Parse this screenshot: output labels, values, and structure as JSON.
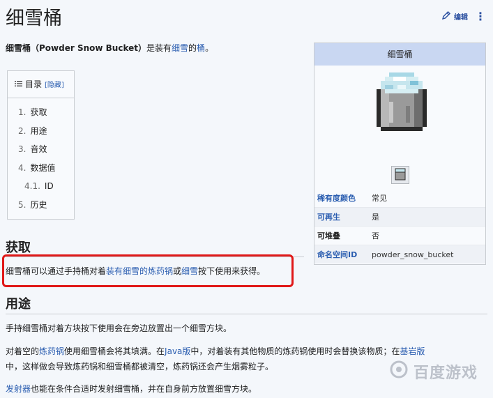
{
  "page": {
    "title": "细雪桶",
    "edit_label": "编辑",
    "more_label": "⋮"
  },
  "intro": {
    "bold_term": "细雪桶",
    "bold_english": "（Powder Snow Bucket）",
    "text_1": "是装有",
    "link_1": "细雪",
    "text_2": "的",
    "link_2": "桶",
    "text_3": "。"
  },
  "toc": {
    "heading": "目录",
    "toggle": "[隐藏]",
    "items": [
      {
        "num": "1.",
        "label": "获取"
      },
      {
        "num": "2.",
        "label": "用途"
      },
      {
        "num": "3.",
        "label": "音效"
      },
      {
        "num": "4.",
        "label": "数据值"
      },
      {
        "num": "4.1.",
        "label": "ID"
      },
      {
        "num": "5.",
        "label": "历史"
      }
    ]
  },
  "section_obtain": {
    "heading": "获取",
    "text_1": "细雪桶可以通过手持桶对着",
    "link_1": "装有细雪的炼药锅",
    "text_2": "或",
    "link_2": "细雪",
    "text_3": "按下使用来获得。"
  },
  "section_usage": {
    "heading": "用途",
    "p1": "手持细雪桶对着方块按下使用会在旁边放置出一个细雪方块。",
    "p2_text_1": "对着空的",
    "p2_link_1": "炼药锅",
    "p2_text_2": "使用细雪桶会将其填满。在",
    "p2_link_2": "Java版",
    "p2_text_3": "中，对着装有其他物质的炼药锅使用时会替换该物质；在",
    "p2_link_3": "基岩版",
    "p3": "中，这样做会导致炼药锅和细雪桶都被清空，炼药锅还会产生烟雾粒子。",
    "p4_link": "发射器",
    "p4_text": "也能在条件合适时发射细雪桶，并在自身前方放置细雪方块。"
  },
  "infobox": {
    "title": "细雪桶",
    "rows": [
      {
        "key": "稀有度颜色",
        "value": "常见",
        "key_link": true
      },
      {
        "key": "可再生",
        "value": "是",
        "key_link": true
      },
      {
        "key": "可堆叠",
        "value": "否",
        "key_link": false
      },
      {
        "key": "命名空间ID",
        "value": "powder_snow_bucket",
        "key_link": true
      }
    ]
  },
  "watermark": {
    "text": "百度游戏"
  },
  "colors": {
    "link": "#2a5db0",
    "highlight": "#e01818",
    "infobox_header": "#c9d7f2"
  }
}
